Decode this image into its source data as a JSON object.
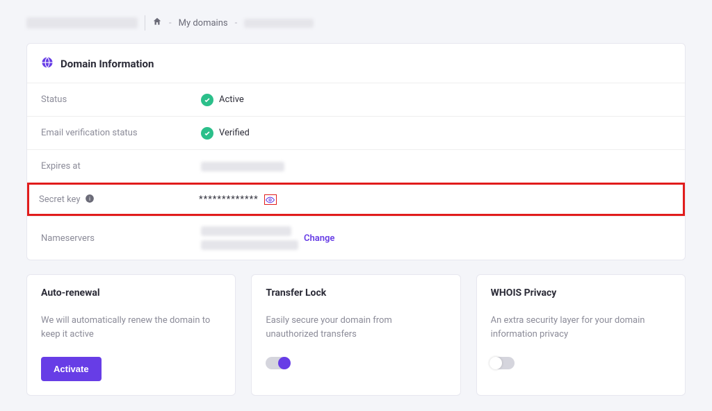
{
  "breadcrumb": {
    "my_domains": "My domains"
  },
  "domain_info": {
    "header": "Domain Information",
    "rows": {
      "status_label": "Status",
      "status_value": "Active",
      "email_label": "Email verification status",
      "email_value": "Verified",
      "expires_label": "Expires at",
      "secret_label": "Secret key",
      "secret_value": "*************",
      "ns_label": "Nameservers",
      "change": "Change"
    }
  },
  "cards": {
    "auto": {
      "title": "Auto-renewal",
      "desc": "We will automatically renew the domain to keep it active",
      "button": "Activate"
    },
    "transfer": {
      "title": "Transfer Lock",
      "desc": "Easily secure your domain from unauthorized transfers"
    },
    "whois": {
      "title": "WHOIS Privacy",
      "desc": "An extra security layer for your domain information privacy"
    }
  }
}
